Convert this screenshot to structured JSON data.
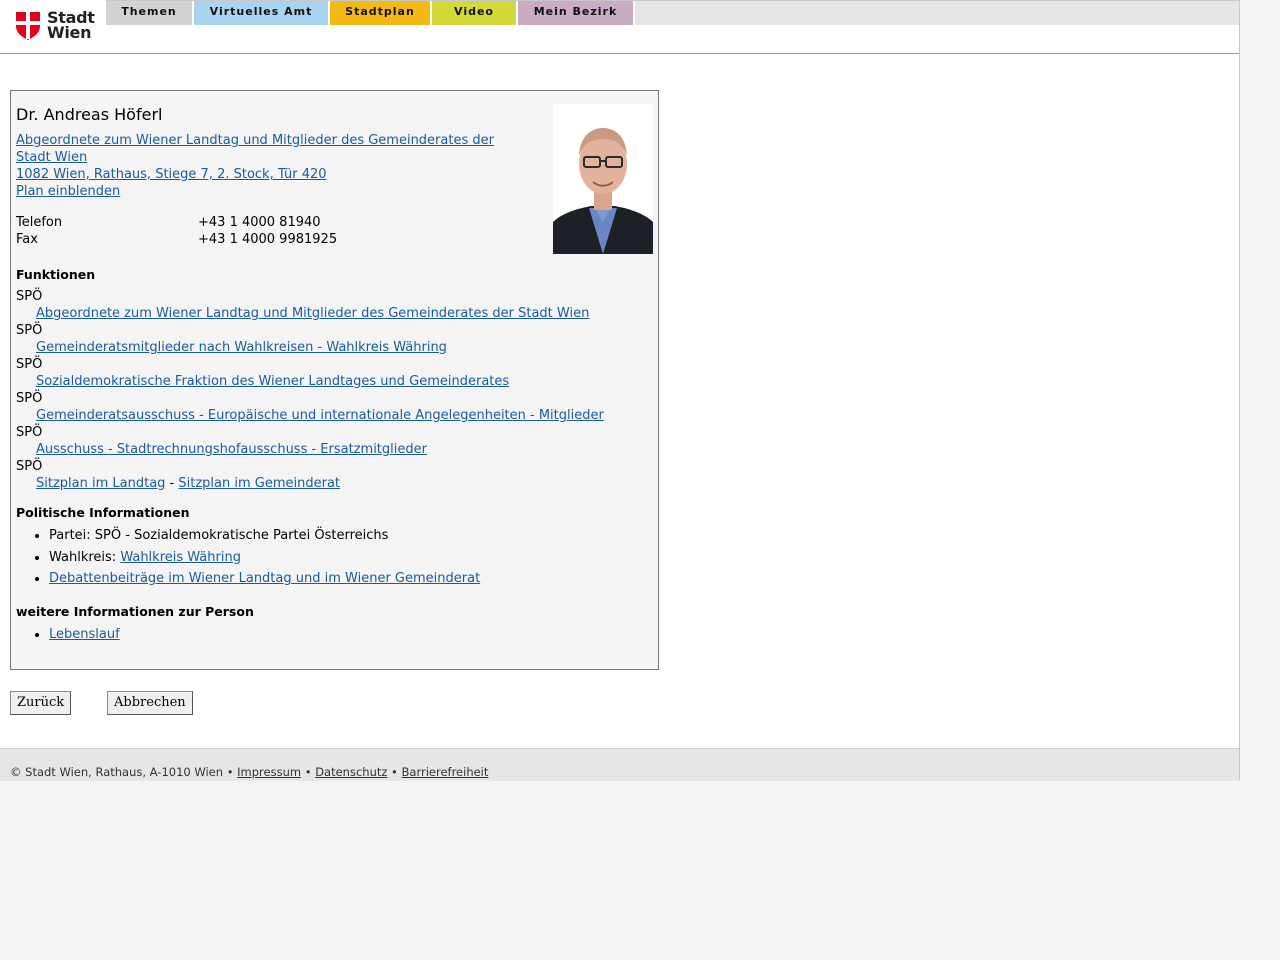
{
  "header": {
    "logo_text_line1": "Stadt",
    "logo_text_line2": "Wien",
    "nav": [
      {
        "label": "Themen",
        "color": "#d3d3d3"
      },
      {
        "label": "Virtuelles Amt",
        "color": "#a9d4ef"
      },
      {
        "label": "Stadtplan",
        "color": "#f5b915"
      },
      {
        "label": "Video",
        "color": "#d4d93a"
      },
      {
        "label": "Mein Bezirk",
        "color": "#c9abc3"
      }
    ]
  },
  "person": {
    "name": "Dr. Andreas Höferl",
    "role_link": "Abgeordnete zum Wiener Landtag und Mitglieder des Gemeinderates der Stadt Wien ",
    "address_link": "1082 Wien, Rathaus, Stiege 7, 2. Stock, Tür 420",
    "plan_link": "Plan einblenden",
    "contacts": [
      {
        "label": "Telefon",
        "value": "+43 1 4000 81940"
      },
      {
        "label": "Fax",
        "value": "+43 1 4000 9981925"
      }
    ]
  },
  "funktionen": {
    "heading": "Funktionen",
    "items": [
      {
        "party": "SPÖ",
        "link": "Abgeordnete zum Wiener Landtag und Mitglieder des Gemeinderates der Stadt Wien"
      },
      {
        "party": "SPÖ",
        "link": "Gemeinderatsmitglieder nach Wahlkreisen - Wahlkreis Währing"
      },
      {
        "party": "SPÖ",
        "link": "Sozialdemokratische Fraktion des Wiener Landtages und Gemeinderates"
      },
      {
        "party": "SPÖ",
        "link": "Gemeinderatsausschuss - Europäische und internationale Angelegenheiten - Mitglieder"
      },
      {
        "party": "SPÖ",
        "link": "Ausschuss - Stadtrechnungshofausschuss - Ersatzmitglieder"
      }
    ],
    "last_party": "SPÖ",
    "sitzplan_landtag": "Sitzplan im Landtag",
    "sitzplan_separator": " - ",
    "sitzplan_gemeinderat": "Sitzplan im Gemeinderat"
  },
  "politisch": {
    "heading": "Politische Informationen",
    "partei": "Partei: SPÖ - Sozialdemokratische Partei Österreichs",
    "wahlkreis_label": "Wahlkreis: ",
    "wahlkreis_link": "Wahlkreis Währing",
    "debatten_link": "Debattenbeiträge im Wiener Landtag und im Wiener Gemeinderat"
  },
  "weitere": {
    "heading": "weitere Informationen zur Person",
    "lebenslauf_link": "Lebenslauf"
  },
  "buttons": {
    "back": "Zurück",
    "cancel": "Abbrechen"
  },
  "footer": {
    "copyright": "© Stadt Wien, Rathaus, A-1010 Wien • ",
    "impressum": "Impressum",
    "sep1": " • ",
    "datenschutz": "Datenschutz",
    "sep2": " • ",
    "barrierefreiheit": "Barrierefreiheit"
  }
}
